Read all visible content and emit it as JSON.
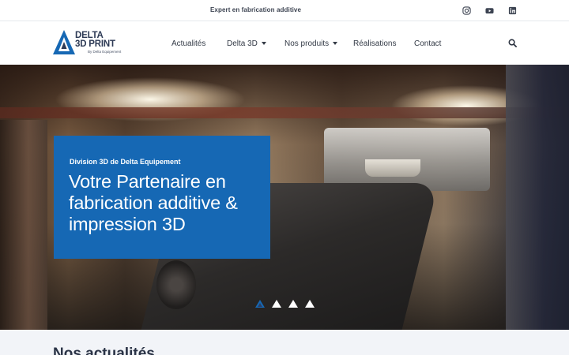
{
  "topbar": {
    "tagline": "Expert en fabrication additive",
    "social": [
      {
        "name": "instagram-icon"
      },
      {
        "name": "youtube-icon"
      },
      {
        "name": "linkedin-icon"
      }
    ]
  },
  "logo": {
    "line1": "DELTA",
    "line2": "3D PRINT",
    "line3": "By Delta Equipement"
  },
  "nav": {
    "items": [
      {
        "label": "Actualités",
        "dropdown": false
      },
      {
        "label": "Delta 3D",
        "dropdown": true
      },
      {
        "label": "Nos produits",
        "dropdown": true
      },
      {
        "label": "Réalisations",
        "dropdown": false
      },
      {
        "label": "Contact",
        "dropdown": false
      }
    ],
    "search_icon": "search-icon"
  },
  "hero": {
    "subtitle": "Division 3D de Delta Equipement",
    "title": "Votre Partenaire en fabrication additive & impression 3D",
    "slides": 4,
    "active_slide": 1
  },
  "news": {
    "heading": "Nos actualités"
  },
  "colors": {
    "brand_blue": "#1668b4",
    "text_dark": "#2c3340",
    "section_bg": "#f2f4f8"
  }
}
